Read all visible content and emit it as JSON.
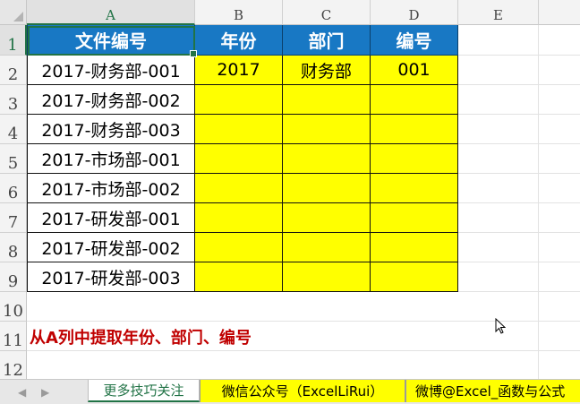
{
  "columns": [
    "A",
    "B",
    "C",
    "D",
    "E"
  ],
  "rows": [
    "1",
    "2",
    "3",
    "4",
    "5",
    "6",
    "7",
    "8",
    "9",
    "10",
    "11",
    "12"
  ],
  "header": [
    "文件编号",
    "年份",
    "部门",
    "编号"
  ],
  "file_ids": [
    "2017-财务部-001",
    "2017-财务部-002",
    "2017-财务部-003",
    "2017-市场部-001",
    "2017-市场部-002",
    "2017-研发部-001",
    "2017-研发部-002",
    "2017-研发部-003"
  ],
  "first_result": {
    "year": "2017",
    "department": "财务部",
    "number": "001"
  },
  "note": "从A列中提取年份、部门、编号",
  "tabs": [
    "更多技巧关注",
    "微信公众号（ExcelLiRui）",
    "微博@Excel_函数与公式"
  ],
  "colors": {
    "header_fill": "#1878c4",
    "value_fill": "#ffff00",
    "note_text": "#c00000",
    "selection": "#217346"
  },
  "icons": {
    "tab_prev": "triangle-left-icon",
    "tab_next": "triangle-right-icon",
    "pointer": "mouse-pointer-icon"
  }
}
